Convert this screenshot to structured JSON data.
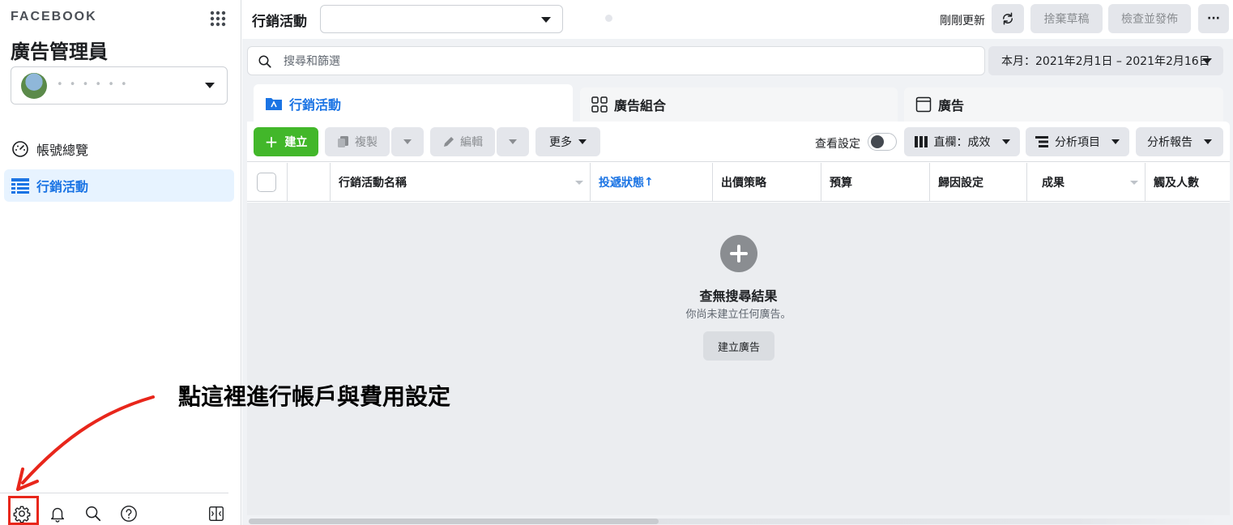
{
  "sidebar": {
    "brand": "FACEBOOK",
    "app_title": "廣告管理員",
    "account_name": "• • • • • •",
    "nav": {
      "overview": "帳號總覽",
      "campaigns": "行銷活動"
    },
    "footer_icons": [
      "gear-icon",
      "bell-icon",
      "search-icon",
      "help-icon",
      "panel-toggle-icon"
    ]
  },
  "annotation": {
    "text": "點這裡進行帳戶與費用設定",
    "color": "#e8261b"
  },
  "topbar": {
    "title": "行銷活動",
    "campaign_dropdown_value": "",
    "updated_text": "剛剛更新",
    "discard_label": "捨棄草稿",
    "review_label": "檢查並發佈",
    "more_label": "···"
  },
  "search": {
    "placeholder": "搜尋和篩選"
  },
  "date_range": {
    "label": "本月：2021年2月1日 – 2021年2月16日"
  },
  "tabs": [
    {
      "label": "行銷活動",
      "icon": "folder-icon"
    },
    {
      "label": "廣告組合",
      "icon": "grid-icon"
    },
    {
      "label": "廣告",
      "icon": "ad-frame-icon"
    }
  ],
  "toolbar": {
    "create_label": "建立",
    "copy_label": "複製",
    "edit_label": "編輯",
    "more_label": "更多",
    "view_settings_label": "查看設定",
    "columns_label": "直欄：成效",
    "breakdown_label": "分析項目",
    "reports_label": "分析報告"
  },
  "table": {
    "columns": [
      "行銷活動名稱",
      "投遞狀態",
      "出價策略",
      "預算",
      "歸因設定",
      "成果",
      "觸及人數"
    ],
    "sort_indicator": "↑"
  },
  "empty_state": {
    "title": "查無搜尋結果",
    "subtitle": "你尚未建立任何廣告。",
    "button_label": "建立廣告"
  },
  "colors": {
    "accent_blue": "#1b74e4",
    "create_green": "#42b72a",
    "highlight_red": "#e8261b"
  }
}
